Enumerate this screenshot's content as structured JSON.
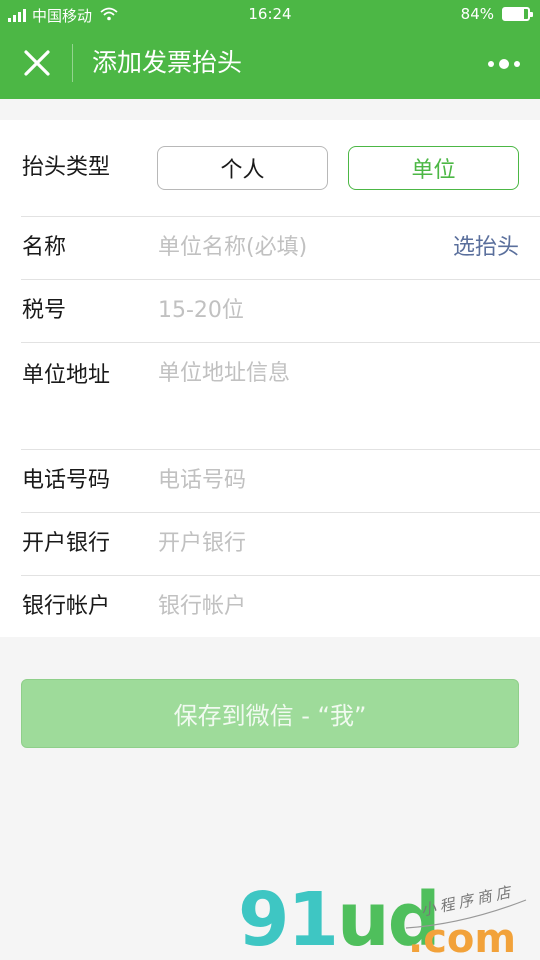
{
  "status_bar": {
    "carrier": "中国移动",
    "time": "16:24",
    "battery": "84%",
    "battery_level": 0.84
  },
  "nav": {
    "title": "添加发票抬头",
    "close_icon": "close-icon",
    "more_icon": "more-icon"
  },
  "form": {
    "type_label": "抬头类型",
    "type_options": [
      "个人",
      "单位"
    ],
    "type_selected": "单位",
    "name_label": "名称",
    "name_placeholder": "单位名称(必填)",
    "pick_link": "选抬头",
    "tax_label": "税号",
    "tax_placeholder": "15-20位",
    "address_label": "单位地址",
    "address_placeholder": "单位地址信息",
    "phone_label": "电话号码",
    "phone_placeholder": "电话号码",
    "bank_label": "开户银行",
    "bank_placeholder": "开户银行",
    "account_label": "银行帐户",
    "account_placeholder": "银行帐户"
  },
  "actions": {
    "save_label": "保存到微信 - “我”"
  },
  "watermark": {
    "logo_a": "91",
    "logo_b": "ud",
    "dotcom": ".com",
    "sub": "小程序商店"
  },
  "colors": {
    "brand_green": "#4cb745",
    "save_button": "#9edb9a",
    "link": "#5a6f9c"
  }
}
